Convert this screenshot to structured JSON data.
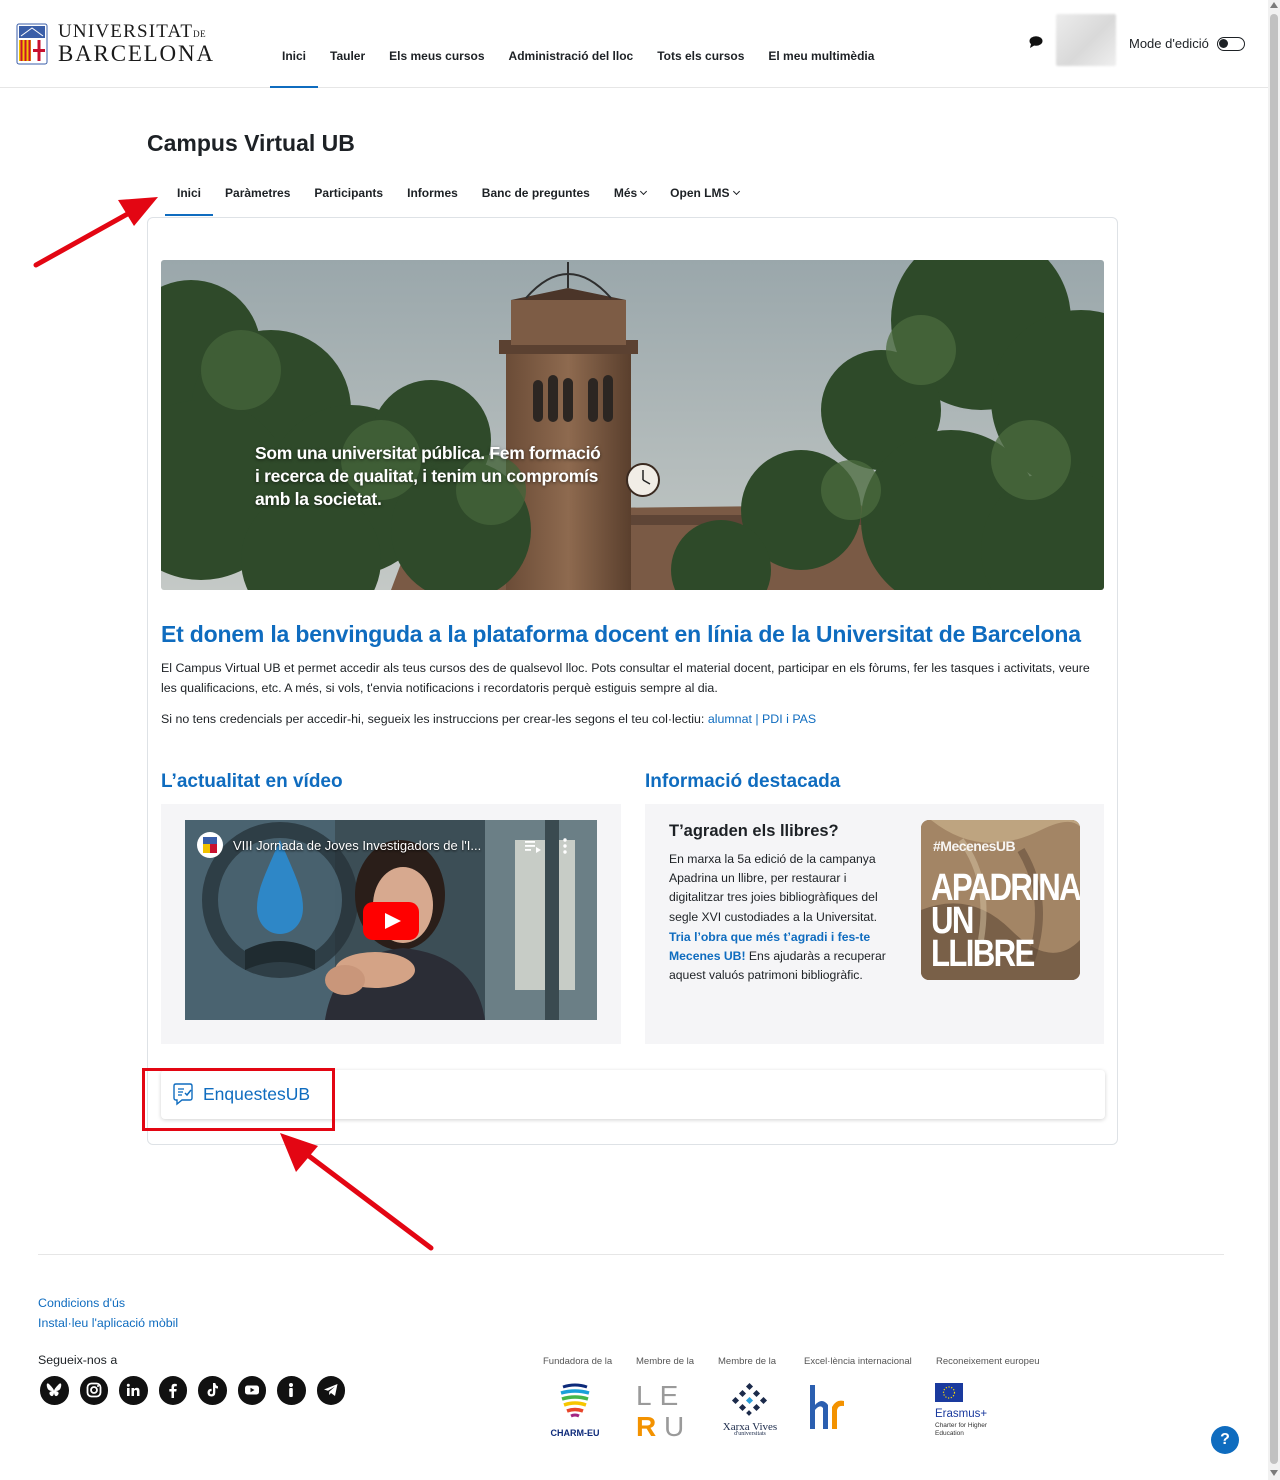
{
  "header": {
    "logo_line1": "UNIVERSITAT",
    "logo_line1_small": "DE",
    "logo_line2": "BARCELONA",
    "nav": [
      {
        "label": "Inici",
        "active": true
      },
      {
        "label": "Tauler"
      },
      {
        "label": "Els meus cursos"
      },
      {
        "label": "Administració del lloc"
      },
      {
        "label": "Tots els cursos"
      },
      {
        "label": "El meu multimèdia"
      }
    ],
    "edit_mode_label": "Mode d'edició",
    "icons": {
      "messages": "chat-bubble-icon"
    }
  },
  "page": {
    "title": "Campus Virtual UB",
    "secondary_nav": [
      {
        "label": "Inici",
        "active": true
      },
      {
        "label": "Paràmetres"
      },
      {
        "label": "Participants"
      },
      {
        "label": "Informes"
      },
      {
        "label": "Banc de preguntes"
      },
      {
        "label": "Més",
        "dropdown": true
      },
      {
        "label": "Open LMS",
        "dropdown": true
      }
    ]
  },
  "hero": {
    "text": "Som una universitat pública. Fem formació i recerca de qualitat, i tenim un compromís amb la societat."
  },
  "welcome": {
    "title": "Et donem la benvinguda a la plataforma docent en línia de la Universitat de Barcelona",
    "paragraph1": "El Campus Virtual UB et permet accedir als teus cursos des de qualsevol lloc. Pots consultar el material docent, participar en els fòrums, fer les tasques i activitats, veure les qualificacions, etc. A més, si vols, t'envia notificacions i recordatoris perquè estiguis sempre al dia.",
    "paragraph2_prefix": "Si no tens credencials per accedir-hi, segueix les instruccions per crear-les segons el teu col·lectiu: ",
    "link_students": "alumnat",
    "separator": " | ",
    "link_staff": "PDI i PAS"
  },
  "video_section": {
    "title": "L’actualitat en vídeo",
    "video_caption": "VIII Jornada de Joves Investigadors de l'I..."
  },
  "info_section": {
    "title": "Informació destacada",
    "heading": "T’agraden els llibres?",
    "body": "En marxa la 5a edició de la campanya Apadrina un llibre, per restaurar i digitalitzar tres joies bibliogràfiques del segle XVI custodiades a la Universitat.",
    "link": "Tria l’obra que més t’agradi i fes-te Mecenes UB!",
    "body_end": " Ens ajudaràs a recuperar aquest valuós patrimoni bibliogràfic.",
    "image_tag": "#MecenesUB",
    "image_title": "APADRINA UN LLIBRE"
  },
  "block": {
    "enquestes_label": "EnquestesUB"
  },
  "footer": {
    "links": [
      "Condicions d'ús",
      "Instal·leu l'aplicació mòbil"
    ],
    "follow_label": "Segueix-nos a",
    "social_icons": [
      "bluesky-icon",
      "instagram-icon",
      "linkedin-icon",
      "facebook-icon",
      "tiktok-icon",
      "youtube-icon",
      "info-icon",
      "telegram-icon"
    ],
    "partners": [
      {
        "label": "Fundadora de la",
        "name": "CHARM-EU"
      },
      {
        "label": "Membre de la",
        "name": "LERU"
      },
      {
        "label": "Membre de la",
        "name": "Xarxa Vives",
        "sub": "d'universitats"
      },
      {
        "label": "Excel·lència internacional",
        "name": "hr"
      },
      {
        "label": "Reconeixement europeu",
        "name": "Erasmus+",
        "sub": "Charter for Higher Education"
      }
    ],
    "help": "?"
  }
}
